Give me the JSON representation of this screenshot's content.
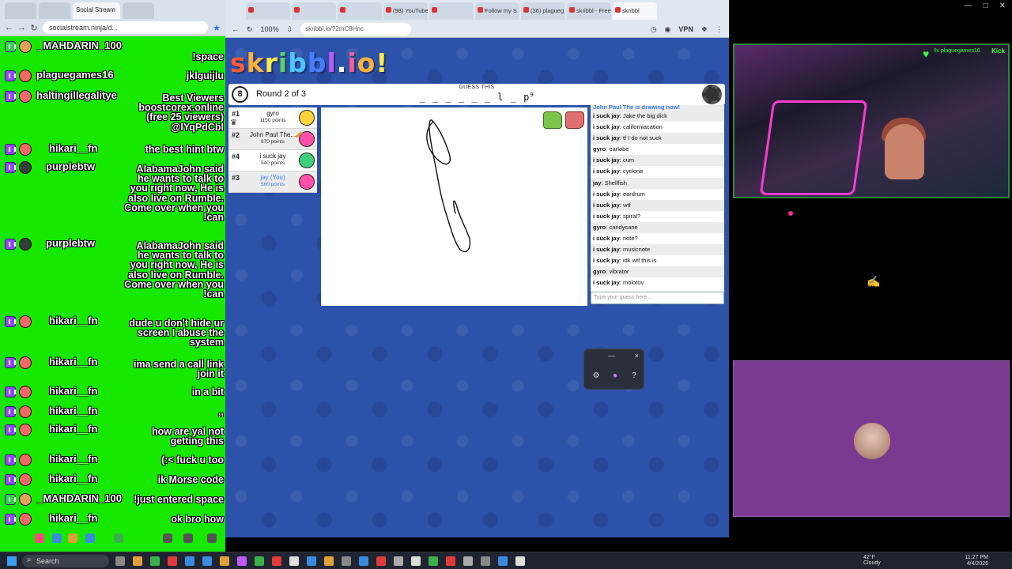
{
  "overlay_browser": {
    "tabs": [
      "",
      "",
      "Social Stream",
      ""
    ],
    "url": "socialstream.ninja/d...",
    "counters": [
      "2",
      "2",
      "6"
    ]
  },
  "chat": {
    "messages": [
      {
        "user": "_MAHDARIN_100",
        "text": "",
        "badge": "kick"
      },
      {
        "user": "",
        "text": "!space",
        "badge": "none"
      },
      {
        "user": "plaguegames16",
        "text": "jklguijlu",
        "badge": "twitch"
      },
      {
        "user": "haltingillegalitye",
        "text": "Best Viewers\nboostcorex.online\n(free 25 viewers)\n@IYqPdCbl",
        "badge": "twitch"
      },
      {
        "user": "hikari__fn",
        "text": "the best hint btw",
        "badge": "twitch"
      },
      {
        "user": "purplebtw",
        "text": "AlabamaJohn said\nhe wants to talk to\nyou right now, He is\nalso live on Rumble.\nCome over when you\n!can",
        "badge": "twitch"
      },
      {
        "user": "purplebtw",
        "text": "AlabamaJohn said\nhe wants to talk to\nyou right now, He is\nalso live on Rumble.\nCome over when you\n!can",
        "badge": "twitch"
      },
      {
        "user": "hikari__fn",
        "text": "dude u don't hide ur\nscreen I abuse the\nsystem",
        "badge": "twitch"
      },
      {
        "user": "hikari__fn",
        "text": "ima send a call link\njoin it",
        "badge": "twitch"
      },
      {
        "user": "hikari__fn",
        "text": "in a bit",
        "badge": "twitch"
      },
      {
        "user": "hikari__fn",
        "text": ",,",
        "badge": "twitch"
      },
      {
        "user": "hikari__fn",
        "text": "how are yal not\ngetting this",
        "badge": "twitch"
      },
      {
        "user": "hikari__fn",
        "text": "(:< fuck u too",
        "badge": "twitch"
      },
      {
        "user": "hikari__fn",
        "text": "ik Morse code",
        "badge": "twitch"
      },
      {
        "user": "_MAHDARIN_100",
        "text": "!just entered space",
        "badge": "kick"
      },
      {
        "user": "hikari__fn",
        "text": "ok bro how",
        "badge": "twitch"
      }
    ]
  },
  "skribbl_browser": {
    "tabs": [
      "",
      "",
      "",
      "(98) YouTube",
      "",
      "Follow my S",
      "(36) plagueg",
      "skribbl - Free",
      "skribbl"
    ],
    "zoom": "100%",
    "url": "skribbl.io/?2mC8Hnc",
    "vpn_label": "VPN"
  },
  "game": {
    "logo": [
      "s",
      "k",
      "r",
      "i",
      "b",
      "b",
      "l",
      ".",
      "i",
      "o",
      "!"
    ],
    "logo_colors": [
      "#ff5a3a",
      "#ffb03a",
      "#ffe94a",
      "#5ad16a",
      "#4ac8ff",
      "#4a7cff",
      "#c05aff",
      "#ffffff",
      "#ff5a9a",
      "#ffb03a",
      "#ffe94a"
    ],
    "timer": "8",
    "round_text": "Round 2 of 3",
    "guess_label": "GUESS THIS",
    "hint": "_ _ _ _ _ _ l _ p",
    "hint_count": "9",
    "players": [
      {
        "rank": "#1",
        "name": "gyro",
        "points": "1150 points",
        "avatar_color": "#ffd33a",
        "crown": true,
        "me": false,
        "drawing": false
      },
      {
        "rank": "#2",
        "name": "John Paul The...",
        "points": "870 points",
        "avatar_color": "#ff4fa8",
        "crown": false,
        "me": false,
        "drawing": true
      },
      {
        "rank": "#4",
        "name": "i suck jay",
        "points": "540 points",
        "avatar_color": "#3ad17a",
        "crown": false,
        "me": false,
        "drawing": false
      },
      {
        "rank": "#3",
        "name": "jay (You)",
        "points": "560 points",
        "avatar_color": "#ff4fa8",
        "crown": false,
        "me": true,
        "drawing": false
      }
    ],
    "chat_system": "John Paul The is drawing now!",
    "chat": [
      {
        "user": "i suck jay",
        "text": "Jake the big dick"
      },
      {
        "user": "i suck jay",
        "text": "californiacation"
      },
      {
        "user": "i suck jay",
        "text": "tf I do not suck"
      },
      {
        "user": "gyro",
        "text": "earlobe"
      },
      {
        "user": "i suck jay",
        "text": "cum"
      },
      {
        "user": "i suck jay",
        "text": "cyclone"
      },
      {
        "user": "jay",
        "text": "Shellfish"
      },
      {
        "user": "i suck jay",
        "text": "eardrum"
      },
      {
        "user": "i suck jay",
        "text": "wtf"
      },
      {
        "user": "i suck jay",
        "text": "spiral?"
      },
      {
        "user": "gyro",
        "text": "candycane"
      },
      {
        "user": "i suck jay",
        "text": "note?"
      },
      {
        "user": "i suck jay",
        "text": "musicnote"
      },
      {
        "user": "i suck jay",
        "text": "idk wtf this is"
      },
      {
        "user": "gyro",
        "text": "vibrator"
      },
      {
        "user": "i suck jay",
        "text": "molotov"
      }
    ],
    "input_placeholder": "Type your guess here..."
  },
  "voice_popup": {
    "minimize": "—",
    "close": "×"
  },
  "webcam": {
    "kick_label": "Kick",
    "top_label": "!lv plaguegames16"
  },
  "taskbar": {
    "search": "Search",
    "weather_temp": "42°F",
    "weather_desc": "Cloudy",
    "time": "11:27 PM",
    "date": "4/4/2026"
  }
}
